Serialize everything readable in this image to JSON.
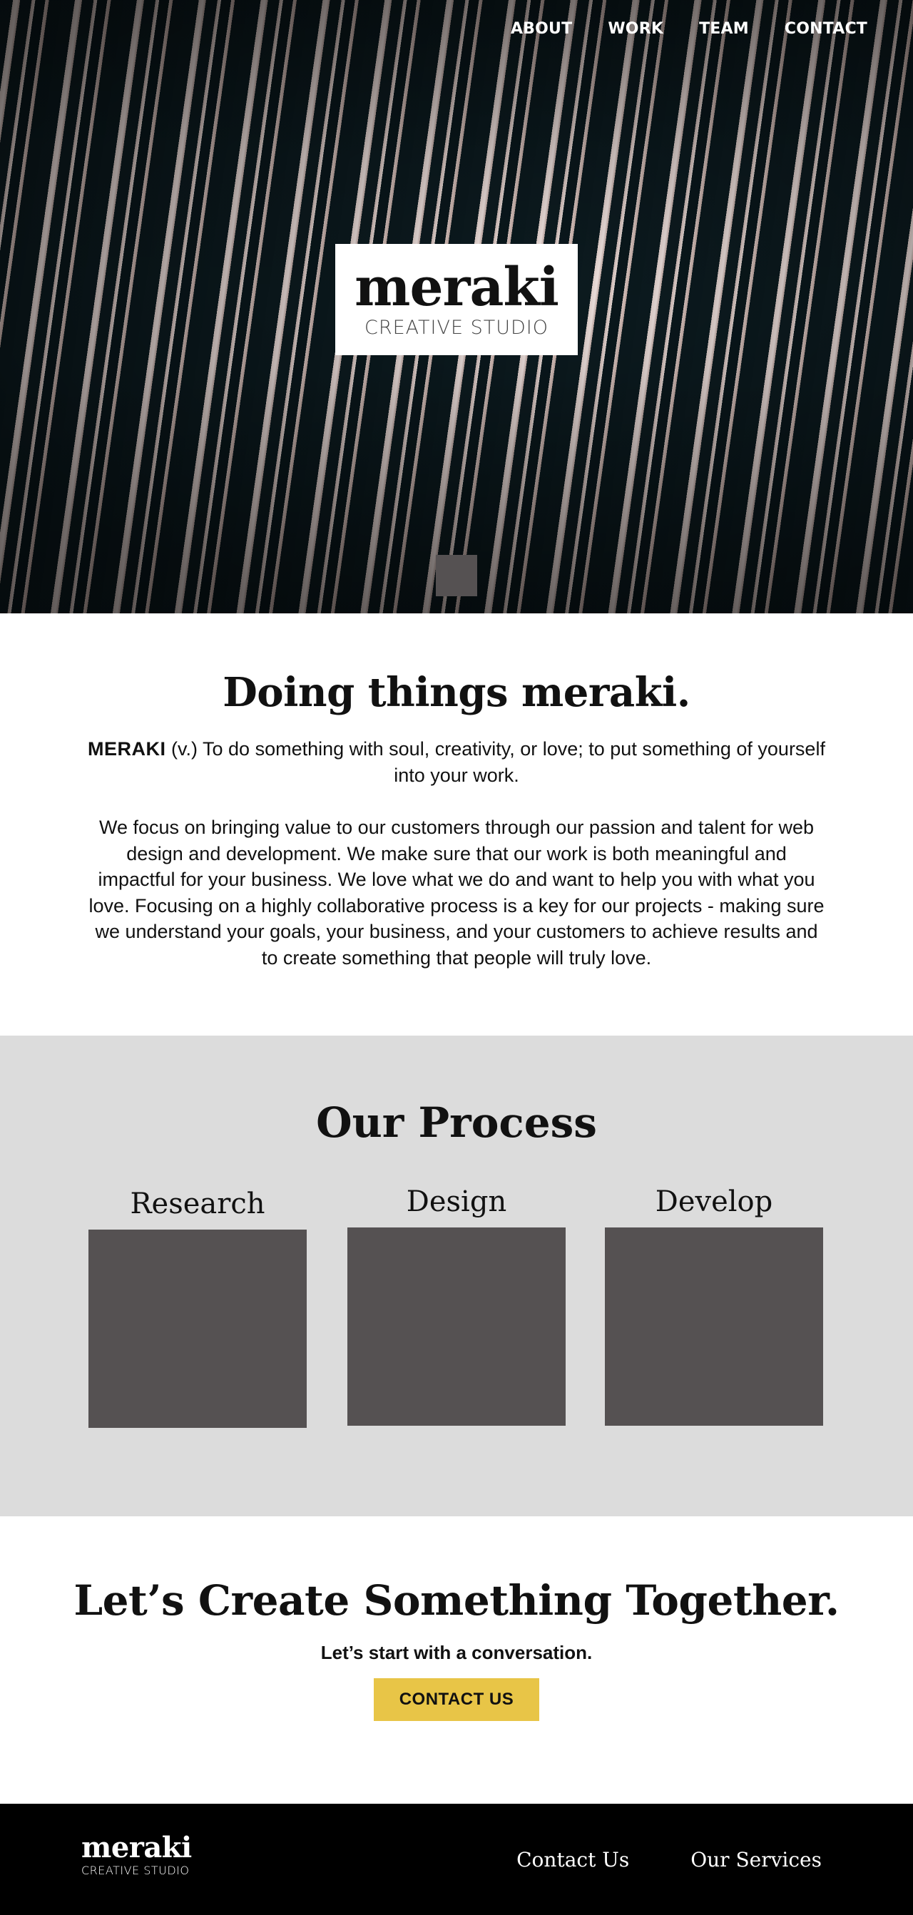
{
  "nav": {
    "items": [
      "ABOUT",
      "WORK",
      "TEAM",
      "CONTACT"
    ]
  },
  "hero": {
    "logo_word": "meraki",
    "logo_subtitle": "CREATIVE STUDIO"
  },
  "about": {
    "heading": "Doing things meraki.",
    "term": "MERAKI",
    "definition": " (v.) To do something with soul, creativity, or love; to put something of yourself into your work.",
    "body": "We focus on bringing value to our customers through our passion and talent for web design and development. We make sure that our work is both meaningful and impactful for your business. We love what we do and want to help you with what you love. Focusing on a highly collaborative process is a key for our projects - making sure we understand your goals, your business, and your customers to achieve results and to create something that people will truly love."
  },
  "process": {
    "heading": "Our Process",
    "steps": [
      {
        "title": "Research"
      },
      {
        "title": "Design"
      },
      {
        "title": "Develop"
      }
    ]
  },
  "cta": {
    "heading": "Let’s Create Something Together.",
    "subheading": "Let’s start with a conversation.",
    "button_label": "CONTACT US"
  },
  "footer": {
    "logo_word": "meraki",
    "logo_subtitle": "CREATIVE STUDIO",
    "links": [
      "Contact Us",
      "Our Services"
    ]
  },
  "colors": {
    "accent_yellow": "#e8c547",
    "placeholder_gray": "#555152",
    "section_gray": "#dcdcdc",
    "footer_black": "#000000"
  }
}
